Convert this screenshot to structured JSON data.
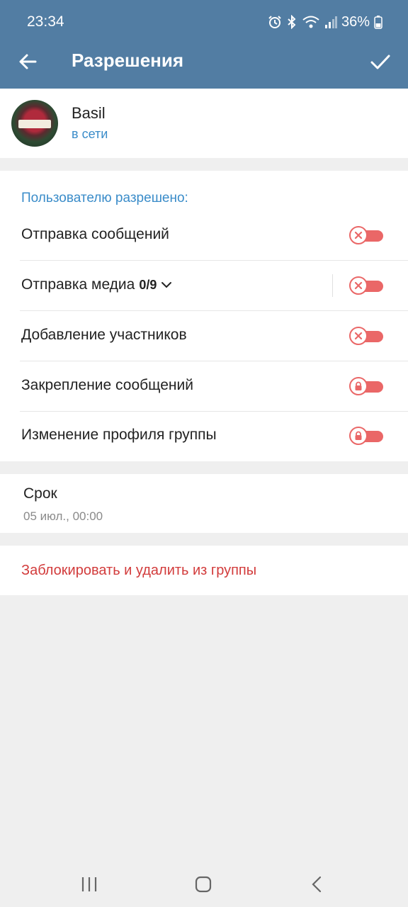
{
  "status_bar": {
    "time": "23:34",
    "battery": "36%",
    "icons": [
      "alarm-icon",
      "bluetooth-icon",
      "wifi-icon",
      "signal-icon",
      "battery-icon"
    ]
  },
  "app_bar": {
    "title": "Разрешения",
    "back_icon": "arrow-left-icon",
    "confirm_icon": "check-icon",
    "background": "#527da3"
  },
  "user": {
    "name": "Basil",
    "status": "в сети"
  },
  "permissions": {
    "section_title": "Пользователю разрешено:",
    "items": [
      {
        "label": "Отправка сообщений",
        "count": "",
        "state": "off",
        "icon": "x-icon"
      },
      {
        "label": "Отправка медиа",
        "count": "0/9",
        "state": "off",
        "icon": "x-icon"
      },
      {
        "label": "Добавление участников",
        "count": "",
        "state": "off",
        "icon": "x-icon"
      },
      {
        "label": "Закрепление сообщений",
        "count": "",
        "state": "locked",
        "icon": "lock-icon"
      },
      {
        "label": "Изменение профиля группы",
        "count": "",
        "state": "locked",
        "icon": "lock-icon"
      }
    ]
  },
  "term": {
    "title": "Срок",
    "value": "05 июл., 00:00"
  },
  "block_action": {
    "label": "Заблокировать и удалить из группы",
    "color": "#d23b3b"
  },
  "accent_color": "#3a8cc9",
  "toggle_color": "#ea6767"
}
